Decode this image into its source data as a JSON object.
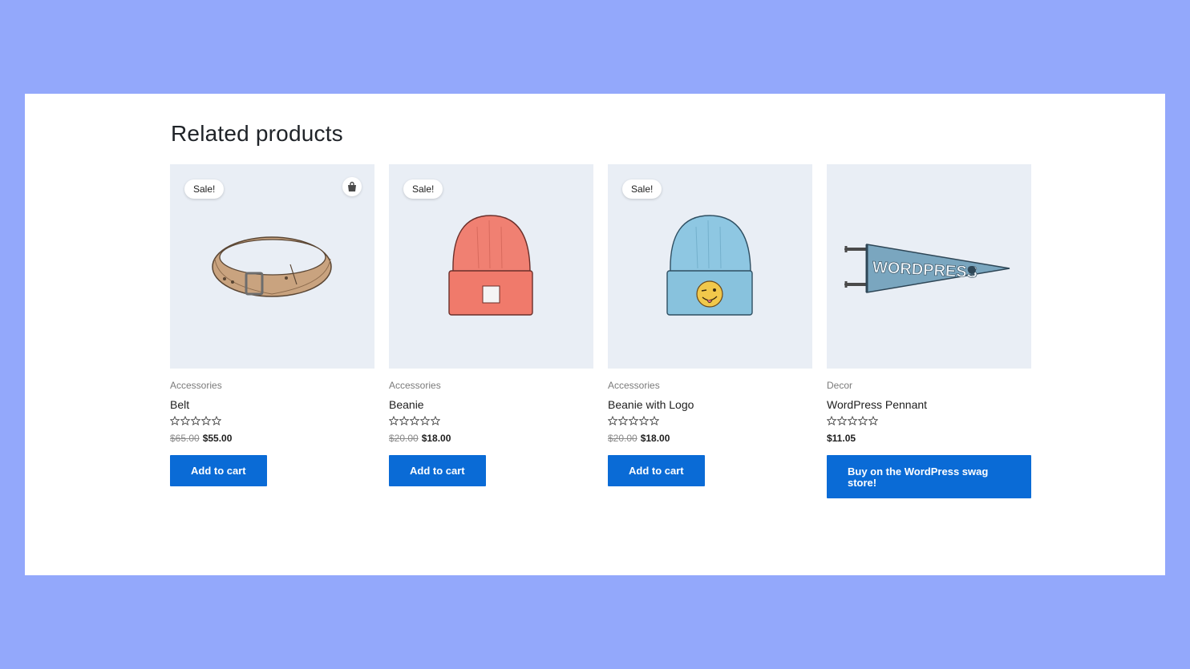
{
  "heading": "Related products",
  "accent_color": "#0a6bd6",
  "products": [
    {
      "badge": "Sale!",
      "category": "Accessories",
      "name": "Belt",
      "rating_stars": 0,
      "old_price": "$65.00",
      "price": "$55.00",
      "button": "Add to cart",
      "image_icon": "belt-image",
      "has_bag_icon": true
    },
    {
      "badge": "Sale!",
      "category": "Accessories",
      "name": "Beanie",
      "rating_stars": 0,
      "old_price": "$20.00",
      "price": "$18.00",
      "button": "Add to cart",
      "image_icon": "beanie-image"
    },
    {
      "badge": "Sale!",
      "category": "Accessories",
      "name": "Beanie with Logo",
      "rating_stars": 0,
      "old_price": "$20.00",
      "price": "$18.00",
      "button": "Add to cart",
      "image_icon": "beanie-with-logo-image"
    },
    {
      "category": "Decor",
      "name": "WordPress Pennant",
      "rating_stars": 0,
      "price": "$11.05",
      "button": "Buy on the WordPress swag store!",
      "image_icon": "pennant-image",
      "pennant_text": "WORDPRESS"
    }
  ]
}
